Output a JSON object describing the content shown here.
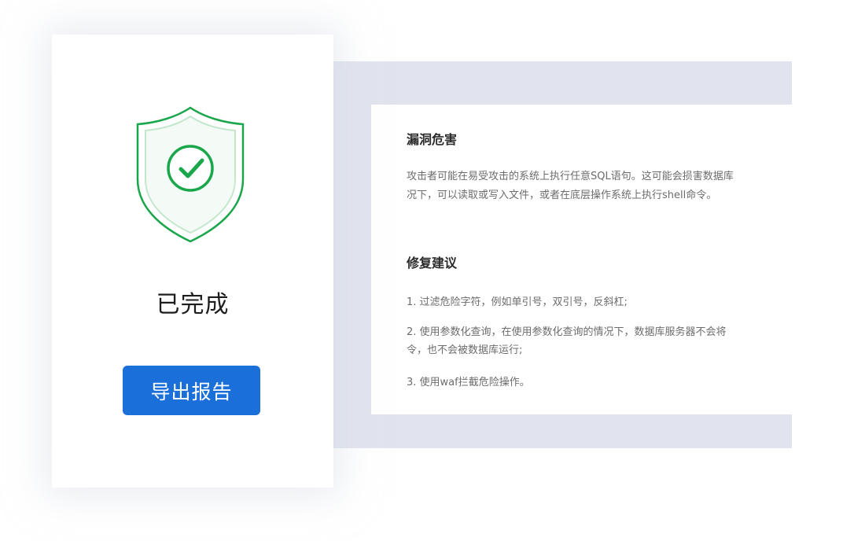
{
  "status": {
    "label": "已完成",
    "icon": "shield-check-icon",
    "colors": {
      "shield": "#1aa64a",
      "shield_light": "#bfe5c9"
    }
  },
  "actions": {
    "export_label": "导出报告",
    "export_color": "#1a6fd9"
  },
  "report": {
    "harm": {
      "title": "漏洞危害",
      "lines": [
        "攻击者可能在易受攻击的系统上执行任意SQL语句。这可能会损害数据库",
        "况下，可以读取或写入文件，或者在底层操作系统上执行shell命令。"
      ]
    },
    "fix": {
      "title": "修复建议",
      "items": [
        {
          "lines": [
            "1. 过滤危险字符，例如单引号，双引号，反斜杠;"
          ]
        },
        {
          "lines": [
            "2. 使用参数化查询，在使用参数化查询的情况下，数据库服务器不会将",
            "令，也不会被数据库运行;"
          ]
        },
        {
          "lines": [
            "3. 使用waf拦截危险操作。"
          ]
        }
      ]
    }
  }
}
